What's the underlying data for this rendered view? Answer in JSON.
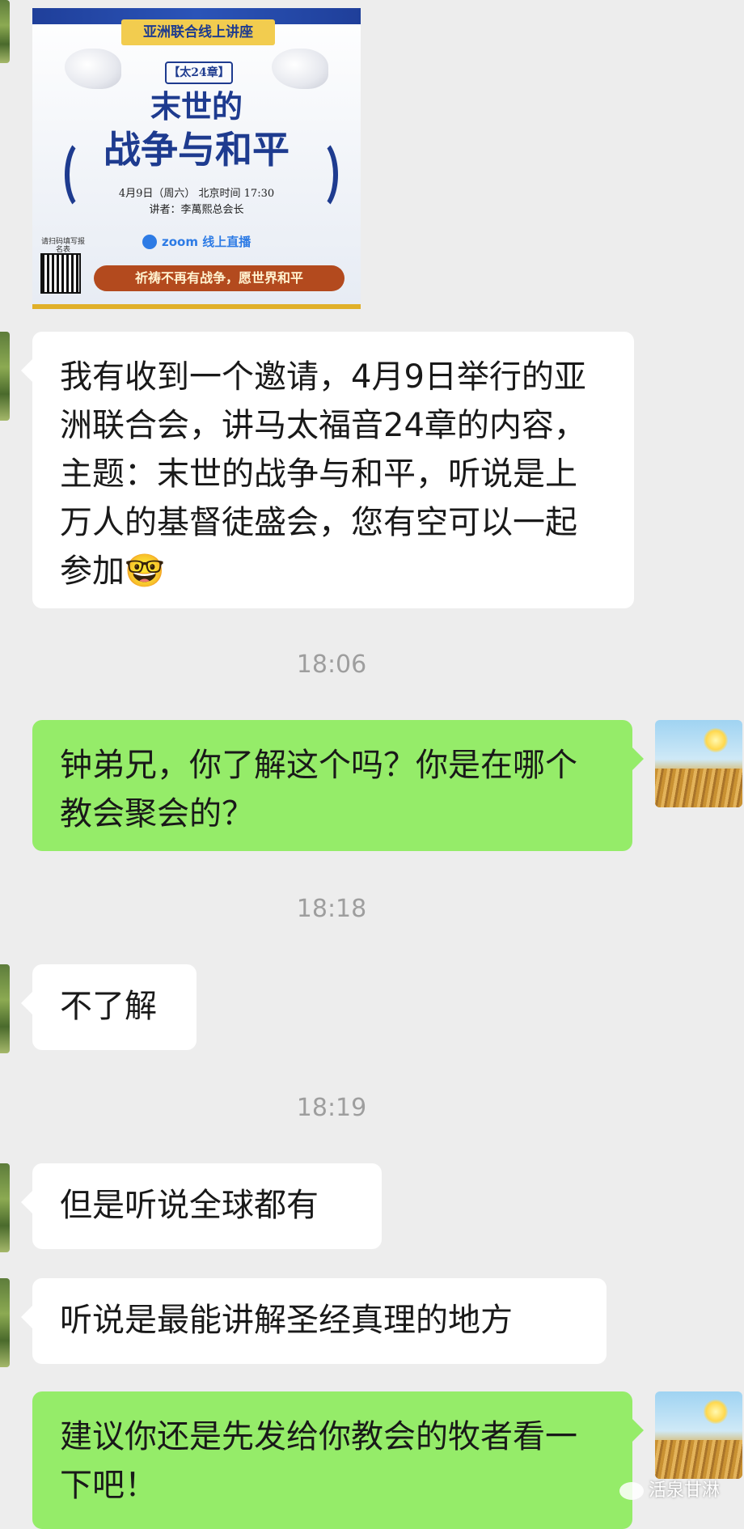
{
  "poster": {
    "banner": "亚洲联合线上讲座",
    "chapter": "【太24章】",
    "title_line1": "末世的",
    "title_line2": "战争与和平",
    "date_line": "4月9日（周六） 北京时间 17:30",
    "speaker_line": "讲者：李萬熙总会长",
    "zoom_label": "zoom 线上直播",
    "qr_label": "请扫码填写报名表",
    "footer": "祈祷不再有战争，愿世界和平"
  },
  "messages": [
    {
      "side": "in",
      "text": "我有收到一个邀请，4月9日举行的亚洲联合会，讲马太福音24章的内容，主题：末世的战争与和平，听说是上万人的基督徒盛会，您有空可以一起参加🤓"
    },
    {
      "time": "18:06"
    },
    {
      "side": "out",
      "text": "钟弟兄，你了解这个吗？你是在哪个教会聚会的？"
    },
    {
      "time": "18:18"
    },
    {
      "side": "in",
      "text": "不了解"
    },
    {
      "time": "18:19"
    },
    {
      "side": "in",
      "text": "但是听说全球都有"
    },
    {
      "side": "in",
      "text": "听说是最能讲解圣经真理的地方"
    },
    {
      "side": "out",
      "text": "建议你还是先发给你教会的牧者看一下吧！"
    }
  ],
  "watermark": "活泉甘淋"
}
